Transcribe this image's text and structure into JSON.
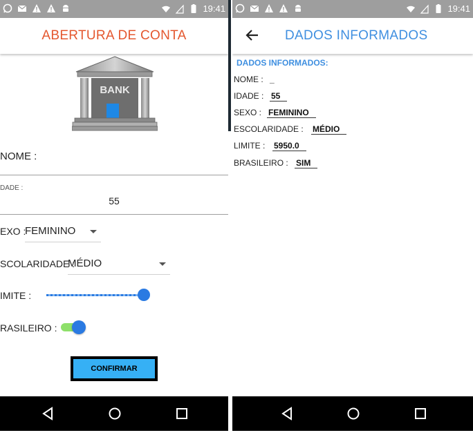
{
  "status_bar": {
    "time": "19:41"
  },
  "left": {
    "title": "ABERTURA DE CONTA",
    "bank_text": "BANK",
    "nome_label": "NOME :",
    "idade_label": "DADE :",
    "idade_value": "55",
    "sexo_label": "EXO :",
    "sexo_value": "FEMININO",
    "escolaridade_label": "SCOLARIDADE :",
    "escolaridade_value": "MÉDIO",
    "limite_label": "IMITE :",
    "limite_level": 1.0,
    "brasileiro_label": "RASILEIRO :",
    "brasileiro_on": true,
    "confirm_label": "CONFIRMAR"
  },
  "right": {
    "title": "DADOS INFORMADOS",
    "section": "DADOS INFORMADOS:",
    "nome_label": "NOME :",
    "nome_value": "_",
    "idade_label": "IDADE :",
    "idade_value": "55",
    "sexo_label": "SEXO :",
    "sexo_value": "FEMININO",
    "escolaridade_label": "ESCOLARIDADE :",
    "escolaridade_value": "MÉDIO",
    "limite_label": "LIMITE :",
    "limite_value": "5950.0",
    "brasileiro_label": "BRASILEIRO :",
    "brasileiro_value": "SIM"
  },
  "colors": {
    "title_left": "#e4572e",
    "title_right": "#3f8fe0",
    "accent": "#2a7ae2",
    "button": "#36b0f5",
    "status_bar": "#9e9e9e"
  },
  "icons": {
    "status": [
      "whatsapp-icon",
      "mail-icon",
      "warning-icon",
      "warning-icon",
      "android-icon"
    ],
    "status_right": [
      "wifi-icon",
      "signal-icon",
      "battery-icon"
    ],
    "nav": [
      "back-nav-icon",
      "home-nav-icon",
      "recents-nav-icon"
    ]
  }
}
